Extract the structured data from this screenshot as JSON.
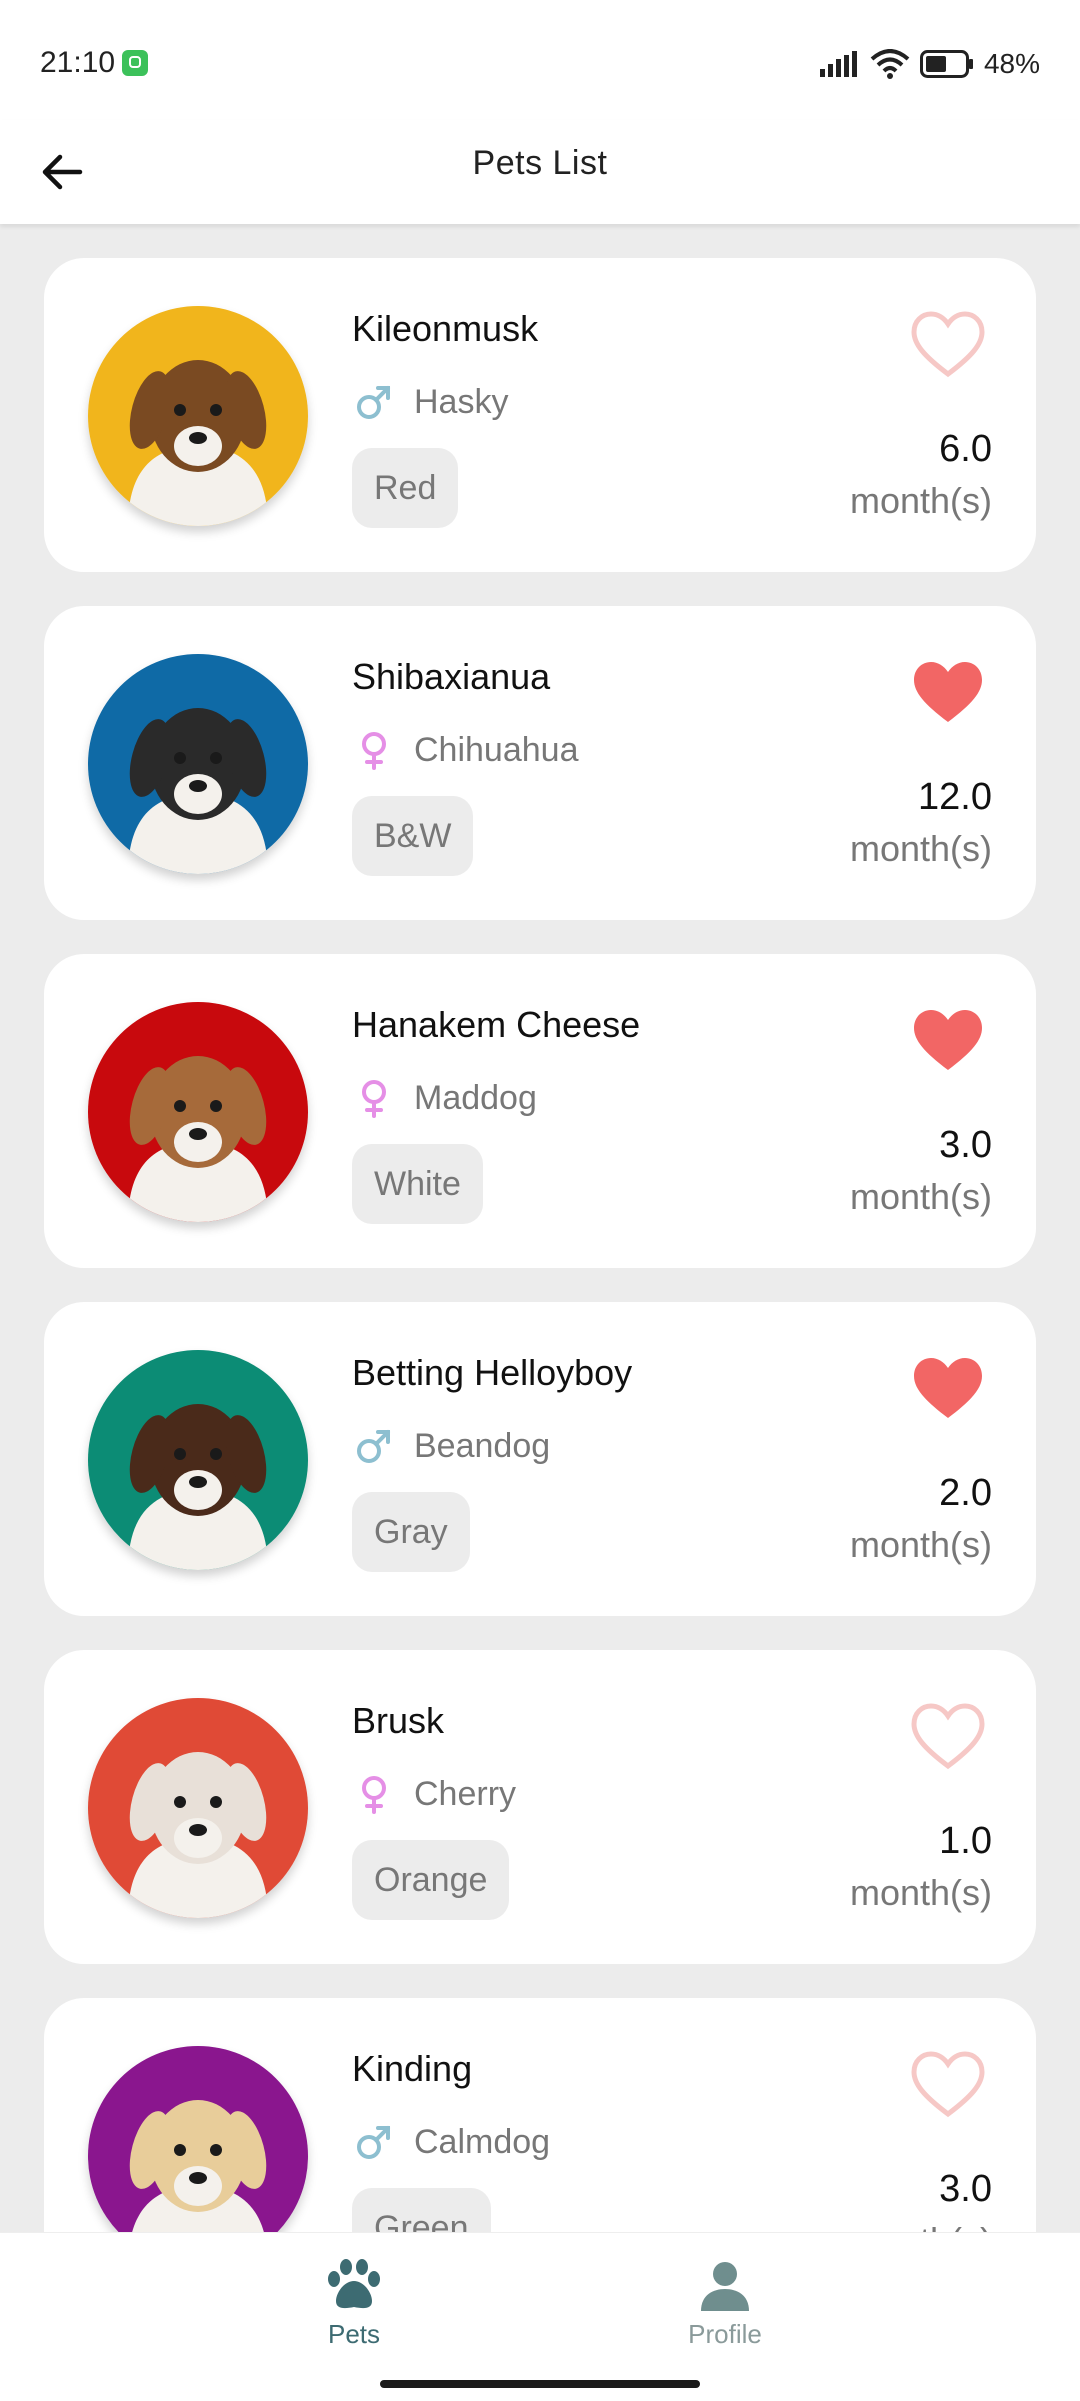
{
  "status_bar": {
    "time": "21:10",
    "battery": "48%"
  },
  "app_bar": {
    "title": "Pets List"
  },
  "pets": [
    {
      "name": "Kileonmusk",
      "gender": "male",
      "breed": "Hasky",
      "color": "Red",
      "age": "6.0",
      "age_unit": "month(s)",
      "favorite": false,
      "avatar_bg": "#f1b51c",
      "fur": "#7a4a22"
    },
    {
      "name": "Shibaxianua",
      "gender": "female",
      "breed": "Chihuahua",
      "color": "B&W",
      "age": "12.0",
      "age_unit": "month(s)",
      "favorite": true,
      "avatar_bg": "#0f6aa6",
      "fur": "#2a2a2a"
    },
    {
      "name": "Hanakem Cheese",
      "gender": "female",
      "breed": "Maddog",
      "color": "White",
      "age": "3.0",
      "age_unit": "month(s)",
      "favorite": true,
      "avatar_bg": "#c8090d",
      "fur": "#a66a3a"
    },
    {
      "name": "Betting Helloyboy",
      "gender": "male",
      "breed": "Beandog",
      "color": "Gray",
      "age": "2.0",
      "age_unit": "month(s)",
      "favorite": true,
      "avatar_bg": "#0c8c75",
      "fur": "#4a2a1a"
    },
    {
      "name": "Brusk",
      "gender": "female",
      "breed": "Cherry",
      "color": "Orange",
      "age": "1.0",
      "age_unit": "month(s)",
      "favorite": false,
      "avatar_bg": "#e04a36",
      "fur": "#e8e0d8"
    },
    {
      "name": "Kinding",
      "gender": "male",
      "breed": "Calmdog",
      "color": "Green",
      "age": "3.0",
      "age_unit": "month(s)",
      "favorite": false,
      "avatar_bg": "#8a168e",
      "fur": "#e8cd9a"
    }
  ],
  "bottom_nav": {
    "items": [
      {
        "label": "Pets",
        "icon": "paw-icon",
        "active": true
      },
      {
        "label": "Profile",
        "icon": "person-icon",
        "active": false
      }
    ]
  },
  "colors": {
    "heart_filled": "#f26665",
    "heart_outline": "#f6c8c6",
    "male": "#8dbfd0",
    "female": "#e58fe6",
    "nav_active": "#3d6b72",
    "nav_inactive": "#8a9a9a"
  }
}
